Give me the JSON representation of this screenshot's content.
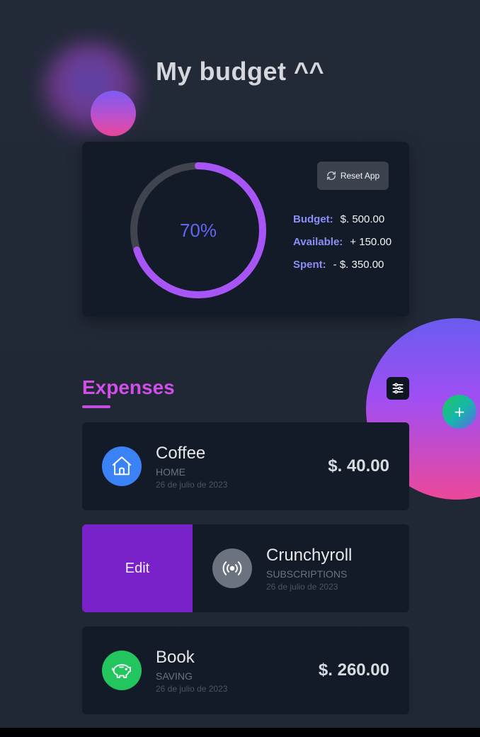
{
  "header": {
    "title": "My budget ^^"
  },
  "summary": {
    "percent_label": "70%",
    "percent_spent": 0.7,
    "reset_label": "Reset App",
    "budget_label": "Budget:",
    "budget_value": "$. 500.00",
    "available_label": "Available:",
    "available_value": "+ 150.00",
    "spent_label": "Spent:",
    "spent_value": "- $. 350.00"
  },
  "expenses": {
    "title": "Expenses",
    "items": [
      {
        "name": "Coffee",
        "category": "HOME",
        "date": "26 de julio de 2023",
        "amount": "$. 40.00",
        "icon": "house-icon",
        "icon_color": "#3b82f6"
      },
      {
        "name": "Crunchyroll",
        "category": "SUBSCRIPTIONS",
        "date": "26 de julio de 2023",
        "amount": "",
        "icon": "broadcast-icon",
        "icon_color": "#6b7280",
        "action_label": "Edit"
      },
      {
        "name": "Book",
        "category": "SAVING",
        "date": "26 de julio de 2023",
        "amount": "$. 260.00",
        "icon": "piggy-bank-icon",
        "icon_color": "#22c55e"
      }
    ]
  },
  "colors": {
    "accent_purple": "#a855f7",
    "title_pink": "#d14ee8",
    "edit_purple": "#7a22c9"
  },
  "fab": {
    "label": "+"
  }
}
